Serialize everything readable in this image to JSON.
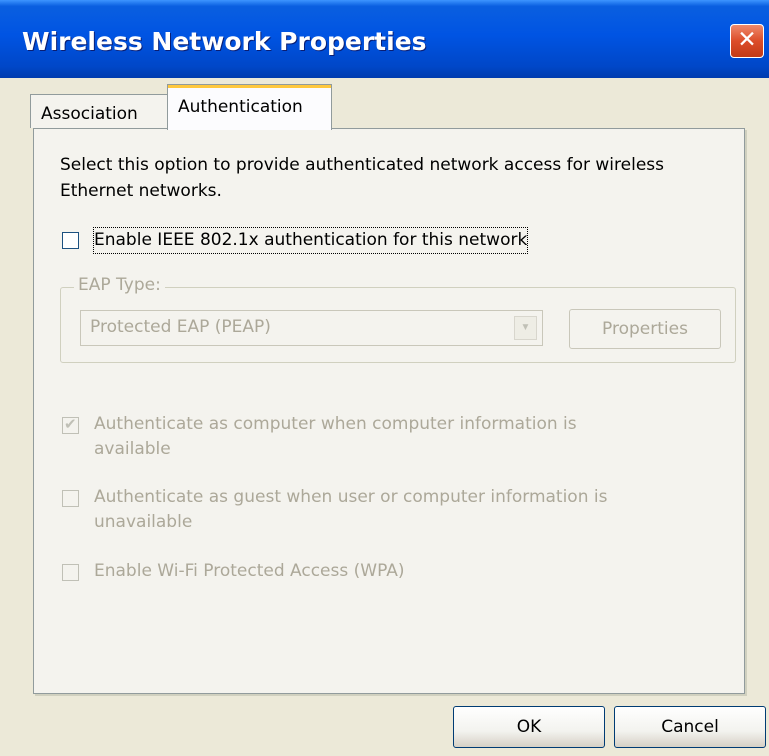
{
  "window": {
    "title": "Wireless Network Properties",
    "close_glyph": "✕"
  },
  "tabs": [
    {
      "label": "Association",
      "selected": false
    },
    {
      "label": "Authentication",
      "selected": true
    }
  ],
  "description": "Select this option to provide authenticated network access for wireless Ethernet networks.",
  "enable_8021x": {
    "label": "Enable IEEE 802.1x authentication for this network",
    "checked": false
  },
  "eap": {
    "legend": "EAP Type:",
    "selected_value": "Protected EAP (PEAP)",
    "dropdown_glyph": "▼",
    "properties_label": "Properties"
  },
  "options": [
    {
      "label_line1": "Authenticate as computer when computer information is",
      "label_line2": "available",
      "checked": true,
      "enabled": false
    },
    {
      "label_line1": "Authenticate as guest when user or computer information is",
      "label_line2": "unavailable",
      "checked": false,
      "enabled": false
    },
    {
      "label_line1": "Enable Wi-Fi Protected Access (WPA)",
      "label_line2": "",
      "checked": false,
      "enabled": false
    }
  ],
  "check_glyph": "✔",
  "buttons": {
    "ok_label": "OK",
    "cancel_label": "Cancel"
  }
}
